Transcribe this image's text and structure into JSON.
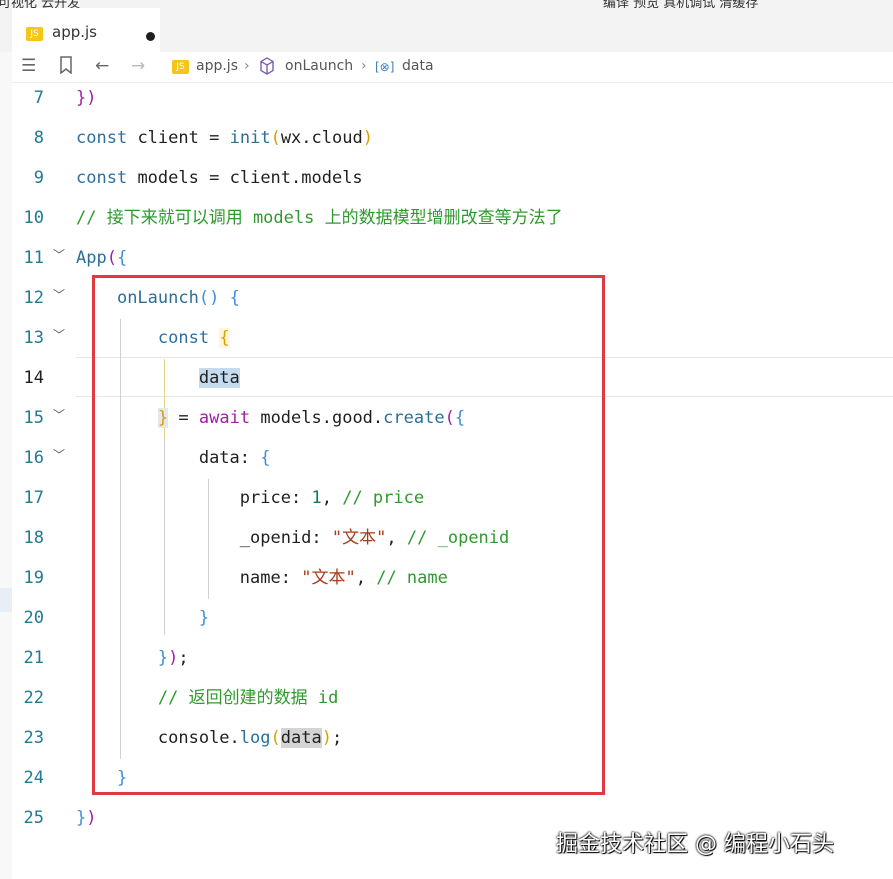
{
  "window_menu": {
    "left": "可视化  云开发",
    "right": "编译  预览  真机调试  清缓存"
  },
  "tab": {
    "icon_text": "JS",
    "label": "app.js"
  },
  "toolbar": {
    "icons": [
      "list-icon",
      "bookmark-icon",
      "back-arrow-icon",
      "forward-arrow-icon"
    ],
    "breadcrumb": [
      {
        "label": "app.js",
        "icon": "js-file-icon"
      },
      {
        "label": "onLaunch",
        "icon": "cube-method-icon"
      },
      {
        "label": "data",
        "icon": "variable-icon"
      }
    ]
  },
  "code": {
    "line_numbers": [
      "7",
      "8",
      "9",
      "10",
      "11",
      "12",
      "13",
      "14",
      "15",
      "16",
      "17",
      "18",
      "19",
      "20",
      "21",
      "22",
      "23",
      "24",
      "25"
    ],
    "tokens": {
      "t_close_paren": "})",
      "t_const": "const",
      "t_client": "client",
      "t_eq": "=",
      "t_init": "init",
      "t_wxcloud": "wx.cloud",
      "t_models": "models",
      "t_client_models": "client.models",
      "t_comment10": "// 接下来就可以调用 models 上的数据模型增删改查等方法了",
      "t_app": "App",
      "t_onlaunch": "onLaunch",
      "t_data": "data",
      "t_await": "await",
      "t_models_good": "models.good.",
      "t_create": "create",
      "t_data_key": "data",
      "t_price": "price",
      "t_one": "1",
      "t_comment17": "// price",
      "t_openid": "_openid",
      "t_str1": "\"文本\"",
      "t_comment18": "// _openid",
      "t_name": "name",
      "t_str2": "\"文本\"",
      "t_comment19": "// name",
      "t_comment22": "// 返回创建的数据 id",
      "t_console": "console.",
      "t_log": "log",
      "t_data2": "data"
    }
  },
  "watermark": "掘金技术社区 @ 编程小石头",
  "colors": {
    "highlight_box": "#e0393e",
    "keyword": "#2f6fa0",
    "comment": "#2e9a2e",
    "string": "#a83a16",
    "line_number": "#237893"
  }
}
